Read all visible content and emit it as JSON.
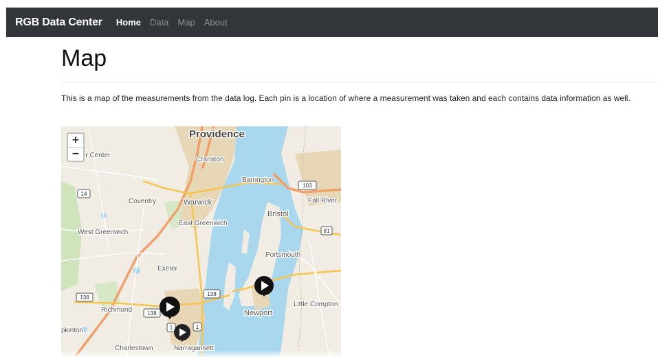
{
  "navbar": {
    "brand": "RGB Data Center",
    "links": [
      {
        "label": "Home",
        "active": true
      },
      {
        "label": "Data",
        "active": false
      },
      {
        "label": "Map",
        "active": false
      },
      {
        "label": "About",
        "active": false
      }
    ]
  },
  "page": {
    "title": "Map",
    "intro": "This is a map of the measurements from the data log. Each pin is a location of where a measurement was taken and each contains data information as well."
  },
  "map": {
    "zoom_in": "+",
    "zoom_out": "−",
    "places": {
      "providence": "Providence",
      "cranston": "Cranston",
      "center": "ter Center",
      "barrington": "Barrington",
      "coventry": "Coventry",
      "warwick": "Warwick",
      "fall_river": "Fall River",
      "bristol": "Bristol",
      "east_greenwich": "East Greenwich",
      "west_greenwich": "West Greenwich",
      "portsmouth": "Portsmouth",
      "exeter": "Exeter",
      "little_compton": "Little Compton",
      "richmond": "Richmond",
      "newport": "Newport",
      "hopkinton": "pkinton",
      "charlestown": "Charlestown",
      "narragansett": "Narragansett"
    },
    "shields": {
      "r103": "103",
      "r14": "14",
      "r81": "81",
      "r138a": "138",
      "r138b": "138",
      "r138c": "138",
      "r1a": "1",
      "r1b": "1"
    },
    "markers": [
      "marker",
      "marker",
      "marker"
    ]
  }
}
